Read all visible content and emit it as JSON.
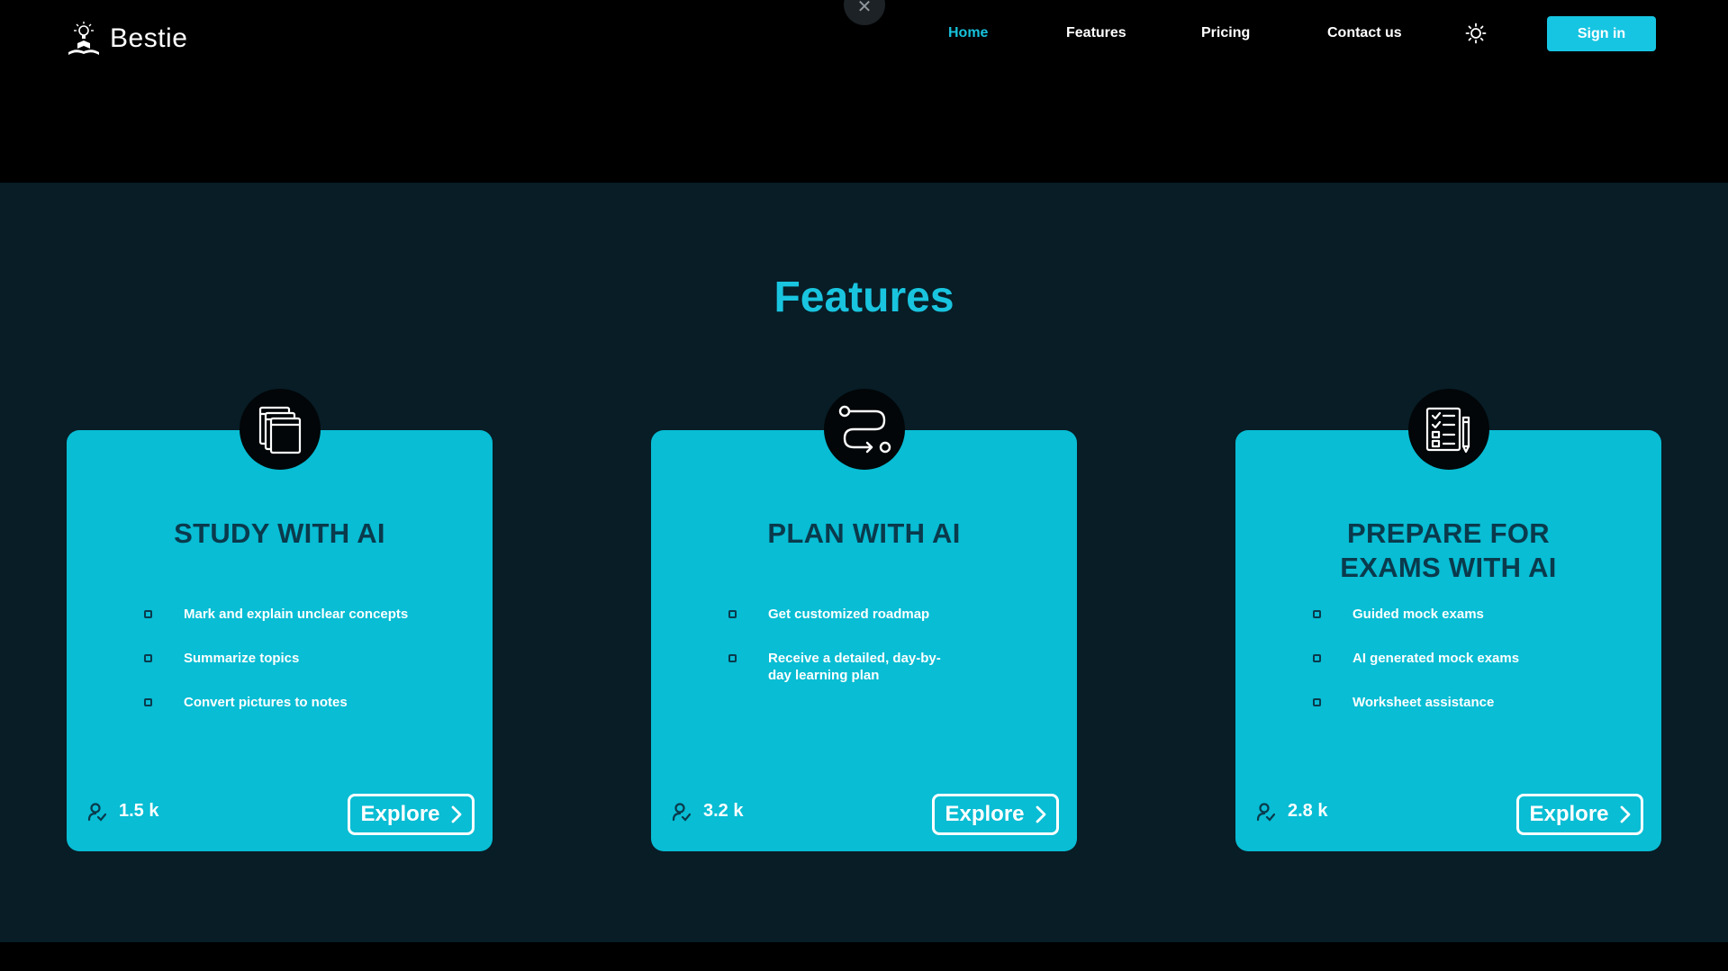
{
  "header": {
    "brand": "Bestie",
    "close_glyph": "✕",
    "nav": [
      {
        "label": "Home",
        "active": true
      },
      {
        "label": "Features",
        "active": false
      },
      {
        "label": "Pricing",
        "active": false
      },
      {
        "label": "Contact us",
        "active": false
      }
    ],
    "theme_icon": "sun-icon",
    "signin_label": "Sign in"
  },
  "features": {
    "title": "Features",
    "cards": [
      {
        "icon": "cards-stack-icon",
        "title": "STUDY WITH AI",
        "bullets": [
          "Mark and explain unclear concepts",
          "Summarize topics",
          "Convert pictures to notes"
        ],
        "count": "1.5 k",
        "cta": "Explore"
      },
      {
        "icon": "route-icon",
        "title": "PLAN WITH AI",
        "bullets": [
          "Get customized roadmap",
          "Receive a detailed, day-by-day learning plan"
        ],
        "count": "3.2 k",
        "cta": "Explore"
      },
      {
        "icon": "checklist-pencil-icon",
        "title": "PREPARE FOR EXAMS WITH AI",
        "bullets": [
          "Guided mock exams",
          "AI generated mock exams",
          "Worksheet assistance"
        ],
        "count": "2.8 k",
        "cta": "Explore"
      }
    ]
  },
  "colors": {
    "accent": "#16c5e2",
    "card_bg": "#08bdd4",
    "section_bg": "#081d26",
    "card_title": "#0a3a4c"
  }
}
